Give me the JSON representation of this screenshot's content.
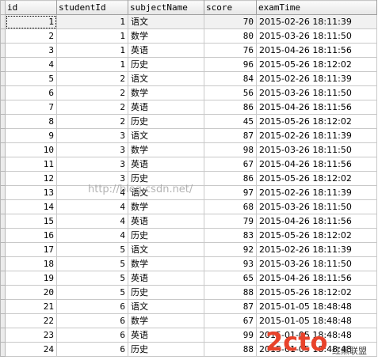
{
  "columns": [
    "id",
    "studentId",
    "subjectName",
    "score",
    "examTime"
  ],
  "rows": [
    [
      "1",
      "1",
      "语文",
      "70",
      "2015-02-26 18:11:39"
    ],
    [
      "2",
      "1",
      "数学",
      "80",
      "2015-03-26 18:11:50"
    ],
    [
      "3",
      "1",
      "英语",
      "76",
      "2015-04-26 18:11:56"
    ],
    [
      "4",
      "1",
      "历史",
      "96",
      "2015-05-26 18:12:02"
    ],
    [
      "5",
      "2",
      "语文",
      "84",
      "2015-02-26 18:11:39"
    ],
    [
      "6",
      "2",
      "数学",
      "56",
      "2015-03-26 18:11:50"
    ],
    [
      "7",
      "2",
      "英语",
      "86",
      "2015-04-26 18:11:56"
    ],
    [
      "8",
      "2",
      "历史",
      "45",
      "2015-05-26 18:12:02"
    ],
    [
      "9",
      "3",
      "语文",
      "87",
      "2015-02-26 18:11:39"
    ],
    [
      "10",
      "3",
      "数学",
      "98",
      "2015-03-26 18:11:50"
    ],
    [
      "11",
      "3",
      "英语",
      "67",
      "2015-04-26 18:11:56"
    ],
    [
      "12",
      "3",
      "历史",
      "86",
      "2015-05-26 18:12:02"
    ],
    [
      "13",
      "4",
      "语文",
      "97",
      "2015-02-26 18:11:39"
    ],
    [
      "14",
      "4",
      "数学",
      "68",
      "2015-03-26 18:11:50"
    ],
    [
      "15",
      "4",
      "英语",
      "79",
      "2015-04-26 18:11:56"
    ],
    [
      "16",
      "4",
      "历史",
      "83",
      "2015-05-26 18:12:02"
    ],
    [
      "17",
      "5",
      "语文",
      "92",
      "2015-02-26 18:11:39"
    ],
    [
      "18",
      "5",
      "数学",
      "93",
      "2015-03-26 18:11:50"
    ],
    [
      "19",
      "5",
      "英语",
      "65",
      "2015-04-26 18:11:56"
    ],
    [
      "20",
      "5",
      "历史",
      "88",
      "2015-05-26 18:12:02"
    ],
    [
      "21",
      "6",
      "语文",
      "87",
      "2015-01-05 18:48:48"
    ],
    [
      "22",
      "6",
      "数学",
      "67",
      "2015-01-05 18:48:48"
    ],
    [
      "23",
      "6",
      "英语",
      "99",
      "2015-01-05 18:48:48"
    ],
    [
      "24",
      "6",
      "历史",
      "88",
      "2015-01-05 18:48:48"
    ]
  ],
  "watermark": "http://blog.csdn.net/",
  "logo": {
    "main": "2cto",
    "sub": "红黑联盟",
    "accent": "#e8432b",
    "dark": "#444444"
  }
}
